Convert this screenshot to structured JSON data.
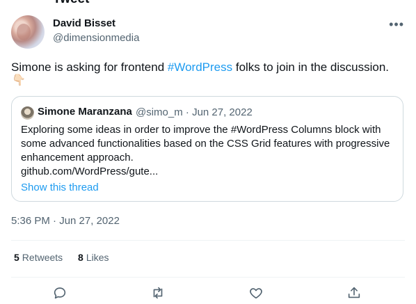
{
  "header": {
    "title": "Tweet"
  },
  "author": {
    "name": "David Bisset",
    "handle": "@dimensionmedia"
  },
  "tweet": {
    "text_before": "Simone is asking for frontend ",
    "hashtag": "#WordPress",
    "text_after": " folks to join in the discussion.",
    "emoji": "👇🏻"
  },
  "quote": {
    "author": "Simone Maranzana",
    "meta": "@simo_m · Jun 27, 2022",
    "text": "Exploring some ideas in order to improve the #WordPress Columns block with some advanced functionalities based on the CSS Grid features with progressive enhancement approach.",
    "link": "github.com/WordPress/gute...",
    "show_thread": "Show this thread"
  },
  "timestamp": "5:36 PM · Jun 27, 2022",
  "stats": {
    "retweets_count": "5",
    "retweets_label": "Retweets",
    "likes_count": "8",
    "likes_label": "Likes"
  },
  "icons": [
    "more-icon",
    "reply-icon",
    "retweet-icon",
    "like-icon",
    "share-icon"
  ]
}
